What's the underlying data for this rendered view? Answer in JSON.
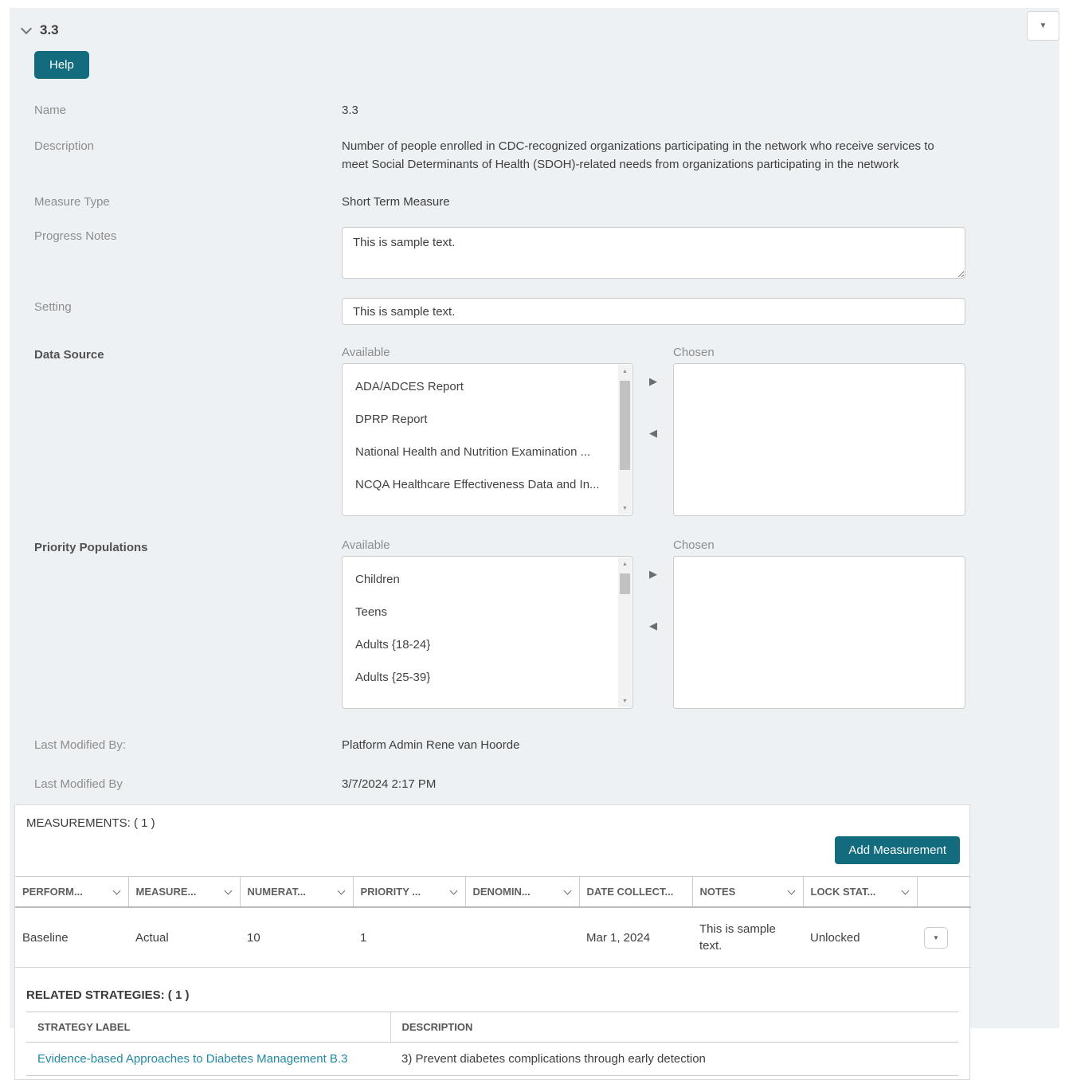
{
  "colors": {
    "teal": "#136c7d",
    "link_teal": "#2189a4",
    "panel_bg": "#edf1f4"
  },
  "icons": {
    "triangle_down": "▼",
    "triangle_right": "▶",
    "triangle_left": "◀",
    "scroll_up": "▲",
    "scroll_down": "▼"
  },
  "section": {
    "title": "3.3"
  },
  "buttons": {
    "help": "Help",
    "add_measurement": "Add Measurement"
  },
  "form": {
    "name": {
      "label": "Name",
      "value": "3.3"
    },
    "description": {
      "label": "Description",
      "value": "Number of people enrolled in CDC-recognized organizations participating in the network who receive services to meet Social Determinants of Health (SDOH)-related needs from organizations participating in the network"
    },
    "measure_type": {
      "label": "Measure Type",
      "value": "Short Term Measure"
    },
    "progress_notes": {
      "label": "Progress Notes",
      "value": "This is sample text."
    },
    "setting": {
      "label": "Setting",
      "value": "This is sample text."
    },
    "data_source": {
      "label": "Data Source",
      "available_label": "Available",
      "chosen_label": "Chosen",
      "available": [
        "ADA/ADCES Report",
        "DPRP Report",
        "National Health and Nutrition Examination ...",
        "NCQA Healthcare Effectiveness Data and In..."
      ],
      "chosen": []
    },
    "priority_populations": {
      "label": "Priority Populations",
      "available_label": "Available",
      "chosen_label": "Chosen",
      "available": [
        "Children",
        "Teens",
        "Adults {18-24}",
        "Adults {25-39}"
      ],
      "chosen": []
    },
    "last_modified_by_name": {
      "label": "Last Modified By:",
      "value": "Platform Admin Rene van Hoorde"
    },
    "last_modified_by_date": {
      "label": "Last Modified By",
      "value": "3/7/2024 2:17 PM"
    }
  },
  "measurements": {
    "title": "MEASUREMENTS: ( 1 )",
    "columns": [
      "PERFORM...",
      "MEASURE...",
      "NUMERAT...",
      "PRIORITY ...",
      "DENOMIN...",
      "DATE COLLECT...",
      "NOTES",
      "LOCK STAT..."
    ],
    "row": [
      "Baseline",
      "Actual",
      "10",
      "1",
      "",
      "Mar 1, 2024",
      "This is sample text.",
      "Unlocked"
    ]
  },
  "related_strategies": {
    "title": "RELATED STRATEGIES: ( 1 )",
    "columns": [
      "STRATEGY LABEL",
      "DESCRIPTION"
    ],
    "row": {
      "label": "Evidence-based Approaches to Diabetes Management B.3",
      "description": "3) Prevent diabetes complications through early detection"
    }
  }
}
